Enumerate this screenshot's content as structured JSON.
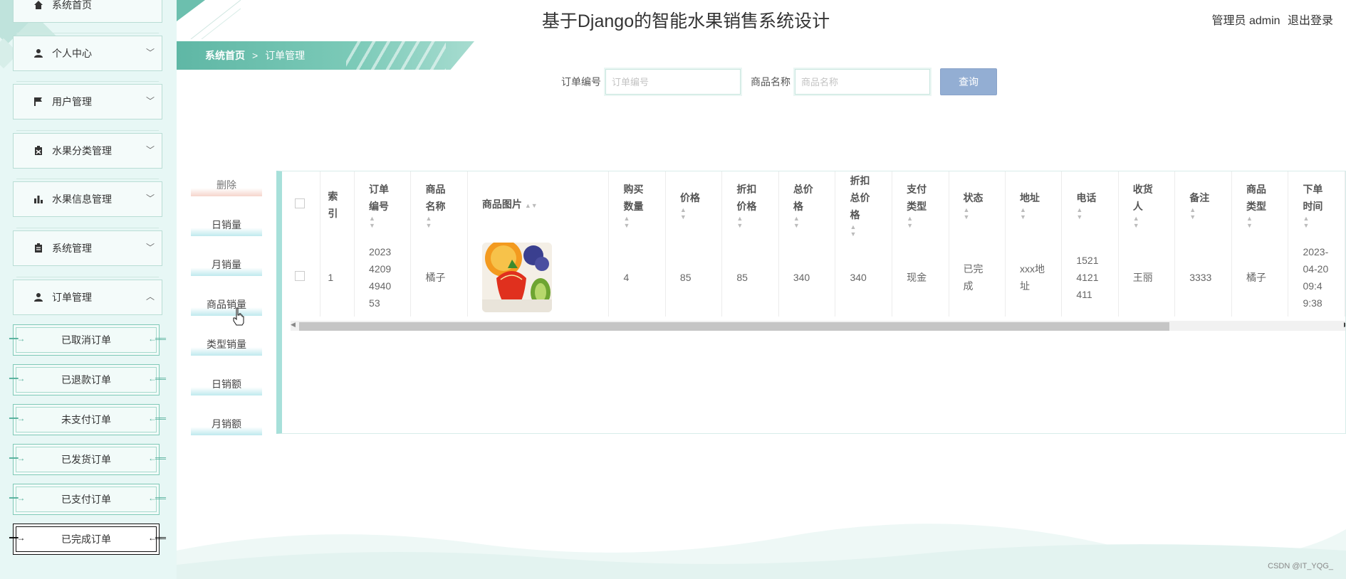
{
  "header": {
    "title": "基于Django的智能水果销售系统设计",
    "user_label": "管理员 admin",
    "logout_label": "退出登录"
  },
  "sidebar": {
    "items": [
      {
        "label": "系统首页",
        "icon": "home-icon"
      },
      {
        "label": "个人中心",
        "icon": "user-icon"
      },
      {
        "label": "用户管理",
        "icon": "flag-icon"
      },
      {
        "label": "水果分类管理",
        "icon": "clipboard-icon"
      },
      {
        "label": "水果信息管理",
        "icon": "bar-chart-icon"
      },
      {
        "label": "系统管理",
        "icon": "document-icon"
      },
      {
        "label": "订单管理",
        "icon": "user-icon",
        "expanded": true
      }
    ],
    "subitems": [
      "已取消订单",
      "已退款订单",
      "未支付订单",
      "已发货订单",
      "已支付订单",
      "已完成订单"
    ],
    "active_subitem": "已完成订单"
  },
  "breadcrumb": {
    "home": "系统首页",
    "separator": ">",
    "current": "订单管理"
  },
  "search": {
    "order_no_label": "订单编号",
    "order_no_placeholder": "订单编号",
    "product_label": "商品名称",
    "product_placeholder": "商品名称",
    "query_button": "查询"
  },
  "actions": [
    "删除",
    "日销量",
    "月销量",
    "商品销量",
    "类型销量",
    "日销额",
    "月销额"
  ],
  "table": {
    "columns": [
      "索引",
      "订单编号",
      "商品名称",
      "商品图片",
      "购买数量",
      "价格",
      "折扣价格",
      "总价格",
      "折扣总价格",
      "支付类型",
      "状态",
      "地址",
      "电话",
      "收货人",
      "备注",
      "商品类型",
      "下单时间"
    ],
    "row": {
      "index": "1",
      "order_no": "202342094940 53",
      "product": "橘子",
      "quantity": "4",
      "price": "85",
      "discount_price": "85",
      "total": "340",
      "discount_total": "340",
      "pay_type": "现金",
      "status": "已完成",
      "address": "xxx地址",
      "phone": "15214121411",
      "receiver": "王丽",
      "note": "3333",
      "product_type": "橘子",
      "order_time": "2023-04-20 09:49:38"
    }
  },
  "watermark": "CSDN @IT_YQG_",
  "colors": {
    "accent": "#5fb7a5",
    "query_button": "#93aed3",
    "sidebar_bg": "#e7f7f5"
  }
}
